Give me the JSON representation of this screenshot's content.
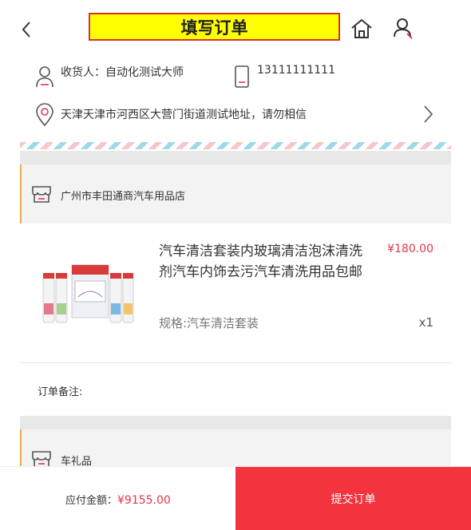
{
  "header": {
    "title": "填写订单",
    "back_icon": "chevron-left-icon",
    "home_icon": "home-icon",
    "user_icon": "user-icon"
  },
  "address": {
    "consignee_label": "收货人：自动化测试大师",
    "phone": "13111111111",
    "full_address": "天津天津市河西区大营门街道测试地址，请勿相信"
  },
  "shops": [
    {
      "name": "广州市丰田通商汽车用品店"
    },
    {
      "name": "车礼品"
    }
  ],
  "product": {
    "title": "汽车清洁套装内玻璃清洁泡沫清洗剂汽车内饰去污汽车清洗用品包邮",
    "price": "¥180.00",
    "spec": "规格:汽车清洁套装",
    "quantity": "x1"
  },
  "remark": {
    "label": "订单备注:"
  },
  "footer": {
    "total_label": "应付金额：",
    "total_amount": "¥9155.00",
    "submit_label": "提交订单"
  },
  "colors": {
    "accent_red": "#f3343e",
    "price_red": "#e8344b",
    "title_bg": "#ffff00",
    "title_border": "#d9302c",
    "shop_accent": "#f0a94a"
  }
}
